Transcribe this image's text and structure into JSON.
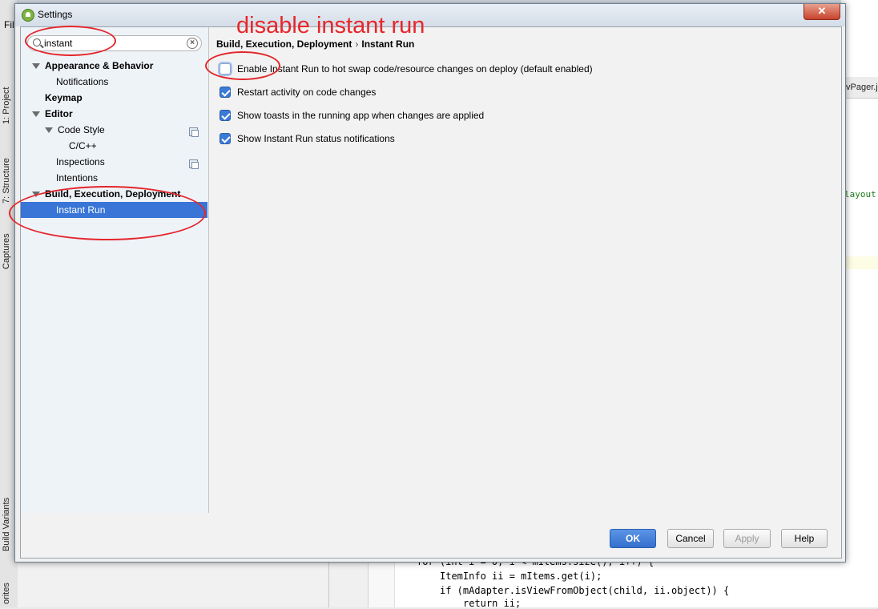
{
  "ide": {
    "menu_file": "Fil",
    "left_tabs": [
      "1: Project",
      "7: Structure",
      "Captures",
      "Build Variants",
      "orites"
    ],
    "right_tab": "vPager.j",
    "right_code": "layout",
    "code_lines": [
      "for (int i = 0; i < mItems.size(); i++) {",
      "ItemInfo ii = mItems.get(i);",
      "if (mAdapter.isViewFromObject(child, ii.object)) {",
      "return ii;"
    ]
  },
  "dialog": {
    "title": "Settings",
    "close_label": "✕"
  },
  "search": {
    "value": "instant",
    "placeholder": ""
  },
  "tree": {
    "items": [
      {
        "label": "Appearance & Behavior"
      },
      {
        "label": "Notifications"
      },
      {
        "label": "Keymap"
      },
      {
        "label": "Editor"
      },
      {
        "label": "Code Style"
      },
      {
        "label": "C/C++"
      },
      {
        "label": "Inspections"
      },
      {
        "label": "Intentions"
      },
      {
        "label": "Build, Execution, Deployment"
      },
      {
        "label": "Instant Run"
      }
    ]
  },
  "breadcrumb": {
    "parent": "Build, Execution, Deployment",
    "separator": "›",
    "current": "Instant Run"
  },
  "options": [
    {
      "label": "Enable Instant Run to hot swap code/resource changes on deploy (default enabled)",
      "checked": false
    },
    {
      "label": "Restart activity on code changes",
      "checked": true
    },
    {
      "label": "Show toasts in the running app when changes are applied",
      "checked": true
    },
    {
      "label": "Show Instant Run status notifications",
      "checked": true
    }
  ],
  "buttons": {
    "ok": "OK",
    "cancel": "Cancel",
    "apply": "Apply",
    "help": "Help"
  },
  "annotation": {
    "text": "disable instant run",
    "color": "#e8262a"
  },
  "colors": {
    "selection": "#3875d7",
    "primary_button": "#3570cc",
    "checkbox": "#3b7ad6"
  }
}
